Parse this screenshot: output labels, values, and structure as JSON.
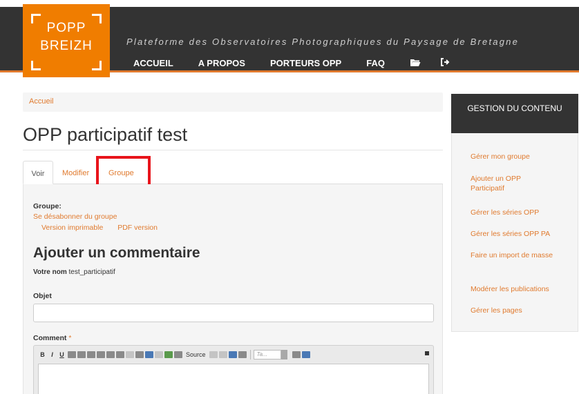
{
  "header": {
    "logo_line1": "POPP",
    "logo_line2": "BREIZH",
    "tagline": "Plateforme des Observatoires Photographiques du Paysage de Bretagne",
    "nav": [
      "ACCUEIL",
      "A PROPOS",
      "PORTEURS OPP",
      "FAQ"
    ],
    "folder_icon": "folder-open-icon",
    "logout_icon": "sign-out-icon"
  },
  "breadcrumb": {
    "home": "Accueil"
  },
  "page": {
    "title": "OPP participatif test",
    "tabs": {
      "voir": "Voir",
      "modifier": "Modifier",
      "groupe": "Groupe"
    }
  },
  "content": {
    "groupe_label": "Groupe:",
    "unsubscribe": "Se désabonner du groupe",
    "print_version": "Version imprimable",
    "pdf_version": "PDF version",
    "comment_heading": "Ajouter un commentaire",
    "name_label": "Votre nom",
    "name_value": "test_participatif",
    "objet_label": "Objet",
    "objet_value": "",
    "comment_label": "Comment",
    "comment_required": "*",
    "editor": {
      "bold": "B",
      "italic": "I",
      "underline": "U",
      "source": "Source",
      "style_placeholder": "Ta..."
    }
  },
  "sidebar": {
    "title": "GESTION DU CONTENU",
    "links": [
      "Gérer mon groupe",
      "Ajouter un OPP Participatif",
      "Gérer les séries OPP",
      "Gérer les séries OPP PA",
      "Faire un import de masse",
      "Modérer les publications",
      "Gérer les pages"
    ]
  },
  "colors": {
    "accent": "#e07a2e",
    "logo": "#f07d00",
    "header_bg": "#333333",
    "highlight": "#e8141b"
  }
}
